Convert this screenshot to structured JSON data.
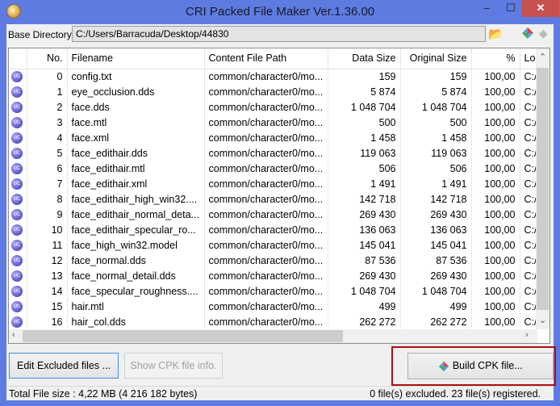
{
  "window": {
    "title": "CRI Packed File Maker Ver.1.36.00",
    "minimize": "‒",
    "maximize": "☐",
    "close": "✕"
  },
  "base_directory": {
    "label": "Base Directory",
    "value": "C:/Users/Barracuda/Desktop/44830"
  },
  "table": {
    "columns": [
      "",
      "No.",
      "Filename",
      "Content File Path",
      "Data Size",
      "Original Size",
      "%",
      "Loc"
    ],
    "rows": [
      [
        "0",
        "config.txt",
        "common/character0/mo...",
        "159",
        "159",
        "100,00",
        "C:/U"
      ],
      [
        "1",
        "eye_occlusion.dds",
        "common/character0/mo...",
        "5 874",
        "5 874",
        "100,00",
        "C:/U"
      ],
      [
        "2",
        "face.dds",
        "common/character0/mo...",
        "1 048 704",
        "1 048 704",
        "100,00",
        "C:/U"
      ],
      [
        "3",
        "face.mtl",
        "common/character0/mo...",
        "500",
        "500",
        "100,00",
        "C:/U"
      ],
      [
        "4",
        "face.xml",
        "common/character0/mo...",
        "1 458",
        "1 458",
        "100,00",
        "C:/U"
      ],
      [
        "5",
        "face_edithair.dds",
        "common/character0/mo...",
        "119 063",
        "119 063",
        "100,00",
        "C:/U"
      ],
      [
        "6",
        "face_edithair.mtl",
        "common/character0/mo...",
        "506",
        "506",
        "100,00",
        "C:/U"
      ],
      [
        "7",
        "face_edithair.xml",
        "common/character0/mo...",
        "1 491",
        "1 491",
        "100,00",
        "C:/U"
      ],
      [
        "8",
        "face_edithair_high_win32....",
        "common/character0/mo...",
        "142 718",
        "142 718",
        "100,00",
        "C:/U"
      ],
      [
        "9",
        "face_edithair_normal_deta...",
        "common/character0/mo...",
        "269 430",
        "269 430",
        "100,00",
        "C:/U"
      ],
      [
        "10",
        "face_edithair_specular_ro...",
        "common/character0/mo...",
        "136 063",
        "136 063",
        "100,00",
        "C:/U"
      ],
      [
        "11",
        "face_high_win32.model",
        "common/character0/mo...",
        "145 041",
        "145 041",
        "100,00",
        "C:/U"
      ],
      [
        "12",
        "face_normal.dds",
        "common/character0/mo...",
        "87 536",
        "87 536",
        "100,00",
        "C:/U"
      ],
      [
        "13",
        "face_normal_detail.dds",
        "common/character0/mo...",
        "269 430",
        "269 430",
        "100,00",
        "C:/U"
      ],
      [
        "14",
        "face_specular_roughness....",
        "common/character0/mo...",
        "1 048 704",
        "1 048 704",
        "100,00",
        "C:/U"
      ],
      [
        "15",
        "hair.mtl",
        "common/character0/mo...",
        "499",
        "499",
        "100,00",
        "C:/U"
      ],
      [
        "16",
        "hair_col.dds",
        "common/character0/mo...",
        "262 272",
        "262 272",
        "100,00",
        "C:/U"
      ]
    ]
  },
  "buttons": {
    "edit_excluded": "Edit Excluded files ...",
    "show_info": "Show CPK file info.",
    "build": "Build CPK file..."
  },
  "status": {
    "total": "Total File size : 4,22 MB (4 216 182 bytes)",
    "counts": "0 file(s) excluded.  23 file(s) registered."
  }
}
